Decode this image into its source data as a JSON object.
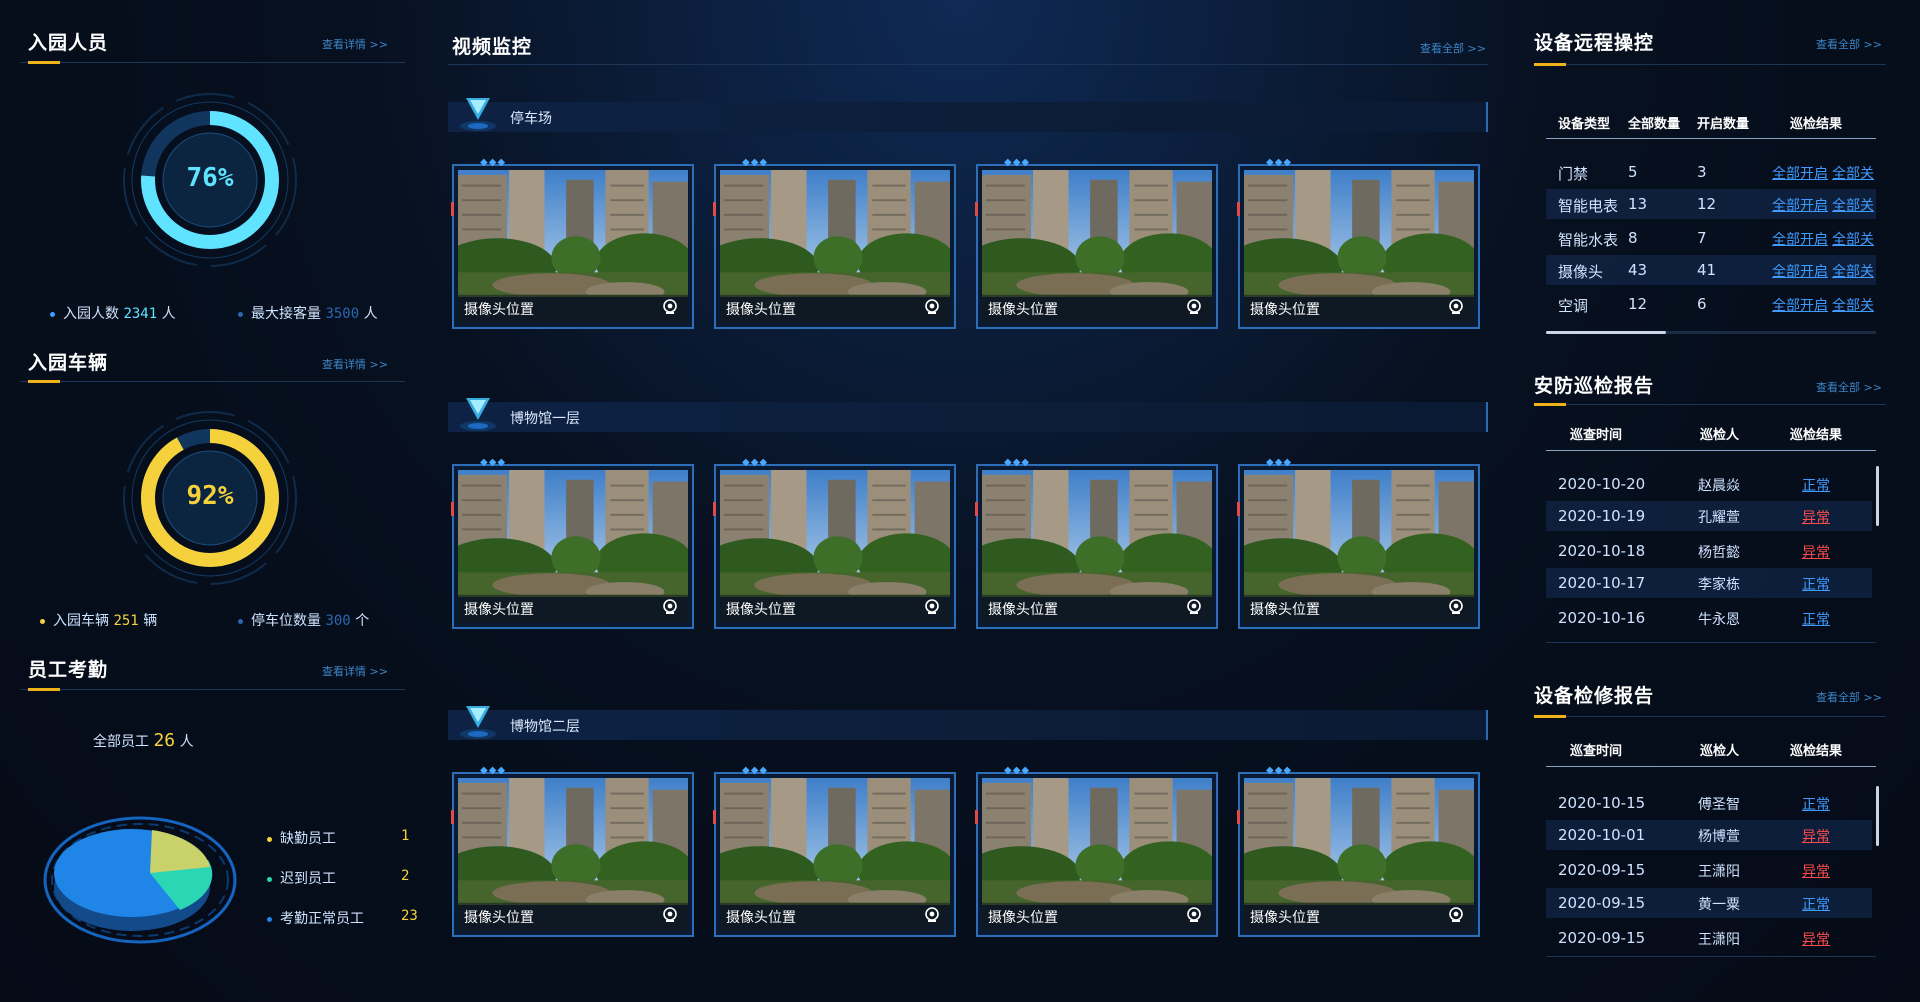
{
  "visitors": {
    "title": "入园人员",
    "more": "查看详情 >>",
    "percent": "76%",
    "ratio": 0.76,
    "count_label": "入园人数",
    "count": "2341",
    "count_unit": "人",
    "max_label": "最大接客量",
    "max": "3500",
    "max_unit": "人"
  },
  "vehicles": {
    "title": "入园车辆",
    "more": "查看详情 >>",
    "percent": "92%",
    "ratio": 0.92,
    "count_label": "入园车辆",
    "count": "251",
    "count_unit": "辆",
    "spaces_label": "停车位数量",
    "spaces": "300",
    "spaces_unit": "个"
  },
  "attendance": {
    "title": "员工考勤",
    "more": "查看详情 >>",
    "total_label": "全部员工",
    "total": "26",
    "total_unit": "人",
    "legend": [
      {
        "label": "缺勤员工",
        "value": "1",
        "color": "#f5d23b"
      },
      {
        "label": "迟到员工",
        "value": "2",
        "color": "#2ad6b3"
      },
      {
        "label": "考勤正常员工",
        "value": "23",
        "color": "#1f86e8"
      }
    ]
  },
  "video": {
    "title": "视频监控",
    "more": "查看全部 >>",
    "sections": [
      {
        "label": "停车场"
      },
      {
        "label": "博物馆一层"
      },
      {
        "label": "博物馆二层"
      }
    ],
    "camera_caption": "摄像头位置"
  },
  "remote": {
    "title": "设备远程操控",
    "more": "查看全部 >>",
    "headers": [
      "设备类型",
      "全部数量",
      "开启数量",
      "巡检结果"
    ],
    "open_all": "全部开启",
    "close_all": "全部关",
    "rows": [
      {
        "type": "门禁",
        "total": "5",
        "on": "3"
      },
      {
        "type": "智能电表",
        "total": "13",
        "on": "12"
      },
      {
        "type": "智能水表",
        "total": "8",
        "on": "7"
      },
      {
        "type": "摄像头",
        "total": "43",
        "on": "41"
      },
      {
        "type": "空调",
        "total": "12",
        "on": "6"
      }
    ]
  },
  "patrol": {
    "title": "安防巡检报告",
    "more": "查看全部 >>",
    "headers": [
      "巡查时间",
      "巡检人",
      "巡检结果"
    ],
    "rows": [
      {
        "date": "2020-10-20",
        "person": "赵晨焱",
        "result": "正常",
        "status": "ok"
      },
      {
        "date": "2020-10-19",
        "person": "孔耀萱",
        "result": "异常",
        "status": "bad"
      },
      {
        "date": "2020-10-18",
        "person": "杨哲懿",
        "result": "异常",
        "status": "bad"
      },
      {
        "date": "2020-10-17",
        "person": "李家栋",
        "result": "正常",
        "status": "ok"
      },
      {
        "date": "2020-10-16",
        "person": "牛永恩",
        "result": "正常",
        "status": "ok"
      }
    ]
  },
  "repair": {
    "title": "设备检修报告",
    "more": "查看全部 >>",
    "headers": [
      "巡查时间",
      "巡检人",
      "巡检结果"
    ],
    "rows": [
      {
        "date": "2020-10-15",
        "person": "傅圣智",
        "result": "正常",
        "status": "ok"
      },
      {
        "date": "2020-10-01",
        "person": "杨博萱",
        "result": "异常",
        "status": "bad"
      },
      {
        "date": "2020-09-15",
        "person": "王潇阳",
        "result": "异常",
        "status": "bad"
      },
      {
        "date": "2020-09-15",
        "person": "黄一粟",
        "result": "正常",
        "status": "ok"
      },
      {
        "date": "2020-09-15",
        "person": "王潇阳",
        "result": "异常",
        "status": "bad"
      }
    ]
  },
  "colors": {
    "accent_cyan": "#5fe3ff",
    "accent_yellow": "#f5d23b",
    "link_blue": "#3f9bff",
    "alert_red": "#ff4d4d"
  }
}
